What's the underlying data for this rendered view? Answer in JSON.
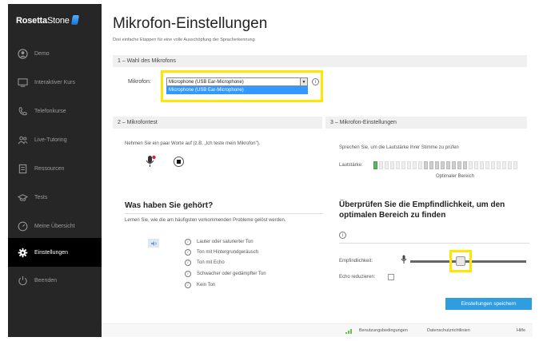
{
  "sidebar": {
    "brand_bold": "Rosetta",
    "brand_light": "Stone",
    "items": [
      {
        "label": "Demo",
        "icon": "user-circle-icon"
      },
      {
        "label": "Interaktiver Kurs",
        "icon": "screen-icon"
      },
      {
        "label": "Telefonkurse",
        "icon": "phone-icon"
      },
      {
        "label": "Live-Tutoring",
        "icon": "people-icon"
      },
      {
        "label": "Ressourcen",
        "icon": "document-icon"
      },
      {
        "label": "Tests",
        "icon": "graduation-cap-icon"
      },
      {
        "label": "Meine Übersicht",
        "icon": "gauge-icon"
      },
      {
        "label": "Einstellungen",
        "icon": "gear-icon"
      },
      {
        "label": "Beenden",
        "icon": "power-icon"
      }
    ]
  },
  "page": {
    "title": "Mikrofon-Einstellungen",
    "subtitle": "Drei einfache Etappen für eine volle Ausschöpfung der Spracherkennung"
  },
  "step1": {
    "header": "1 – Wahl des Mikrofons",
    "mic_label": "Mikrofon:",
    "selected": "Microphone (USB Ear-Microphone)",
    "options": [
      "Microphone (USB Ear-Microphone)"
    ]
  },
  "step2": {
    "header": "2 – Mikrofontest",
    "instruction": "Nehmen Sie ein paar Worte auf (z.B. „Ich teste mein Mikrofon\").",
    "heard_title": "Was haben Sie gehört?",
    "heard_desc": "Lernen Sie, wie die am häufigsten vorkommenden Probleme gelöst werden.",
    "issues": [
      "Lauter oder saturierter Ton",
      "Ton mit Hintergrundgeräusch",
      "Ton mit Echo",
      "Schwacher oder gedämpfter Ton",
      "Kein Ton"
    ]
  },
  "step3": {
    "header": "3 – Mikrofon-Einstellungen",
    "instruction": "Sprechen Sie, um die Lautstärke Ihrer Stimme zu prüfen",
    "volume_label": "Lautstärke:",
    "optimal_label": "Optimaler Bereich",
    "check_title_1": "Überprüfen Sie die Empfindlichkeit, um den",
    "check_title_2": "optimalen Bereich zu finden",
    "sensitivity_label": "Empfindlichkeit:",
    "echo_label": "Echo reduzieren:",
    "echo_checked": false,
    "save_label": "Einstellungen speichern"
  },
  "footer": {
    "terms": "Benutzungsbedingungen",
    "privacy": "Datenschutzrichtlinien",
    "help": "Hilfe"
  },
  "colors": {
    "sidebar_bg": "#262626",
    "active_bg": "#000000",
    "accent": "#2f9de0",
    "highlight": "#ffe600",
    "selection": "#3399ff"
  }
}
